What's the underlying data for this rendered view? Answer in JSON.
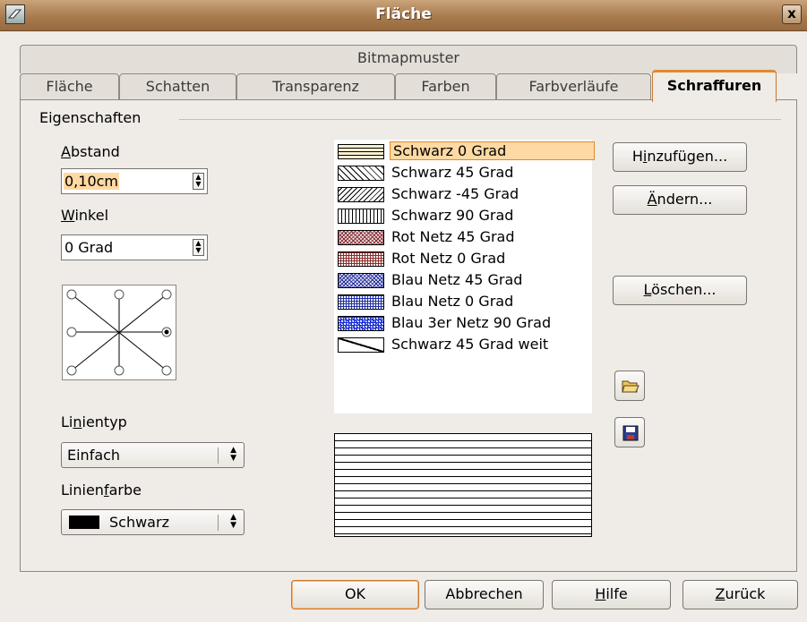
{
  "window": {
    "title": "Fläche",
    "close_glyph": "x"
  },
  "tabs": {
    "row1": [
      {
        "label": "Bitmapmuster"
      }
    ],
    "row2": [
      {
        "label": "Fläche"
      },
      {
        "label": "Schatten"
      },
      {
        "label": "Transparenz"
      },
      {
        "label": "Farben"
      },
      {
        "label": "Farbverläufe"
      },
      {
        "label": "Schraffuren",
        "active": true
      }
    ]
  },
  "properties": {
    "group_label": "Eigenschaften",
    "abstand": {
      "label_first": "A",
      "label_rest": "bstand",
      "value": "0,10cm"
    },
    "winkel": {
      "label_first": "W",
      "label_rest": "inkel",
      "value": "0 Grad",
      "selected_position": "right-middle"
    },
    "linientyp": {
      "label_pre": "Li",
      "label_mn": "n",
      "label_post": "ientyp",
      "value": "Einfach"
    },
    "linienfarbe": {
      "label_pre": "Linien",
      "label_mn": "f",
      "label_post": "arbe",
      "value": "Schwarz",
      "swatch_color": "#000000"
    }
  },
  "hatch_list": {
    "items": [
      {
        "name": "Schwarz 0 Grad",
        "pattern": "h0",
        "color": "#000000",
        "selected": true
      },
      {
        "name": "Schwarz 45 Grad",
        "pattern": "d45",
        "color": "#000000"
      },
      {
        "name": "Schwarz -45 Grad",
        "pattern": "dm45",
        "color": "#000000"
      },
      {
        "name": "Schwarz 90 Grad",
        "pattern": "v90",
        "color": "#000000"
      },
      {
        "name": "Rot Netz 45 Grad",
        "pattern": "net45",
        "color": "#8b2a2a"
      },
      {
        "name": "Rot Netz 0 Grad",
        "pattern": "net0",
        "color": "#8b2a2a"
      },
      {
        "name": "Blau Netz 45 Grad",
        "pattern": "net45",
        "color": "#1f2f9e"
      },
      {
        "name": "Blau Netz 0 Grad",
        "pattern": "net0",
        "color": "#1f2f9e"
      },
      {
        "name": "Blau 3er Netz 90 Grad",
        "pattern": "net3",
        "color": "#1a2fd6"
      },
      {
        "name": "Schwarz 45 Grad weit",
        "pattern": "wide45",
        "color": "#000000"
      }
    ]
  },
  "side_buttons": {
    "add": {
      "pre": "H",
      "mn": "i",
      "post": "nzufügen..."
    },
    "modify": {
      "pre": "",
      "mn": "Ä",
      "post": "ndern..."
    },
    "delete": {
      "pre": "",
      "mn": "L",
      "post": "öschen..."
    },
    "load_icon": "open-folder-icon",
    "save_icon": "floppy-disk-icon"
  },
  "footer": {
    "ok": "OK",
    "cancel": "Abbrechen",
    "help": {
      "mn": "H",
      "post": "ilfe"
    },
    "reset": {
      "pre": "",
      "mn": "Z",
      "post": "urück"
    }
  },
  "colors": {
    "accent": "#e0892f",
    "selection": "#ffd9a3",
    "title_bar": "#a87b4e"
  }
}
